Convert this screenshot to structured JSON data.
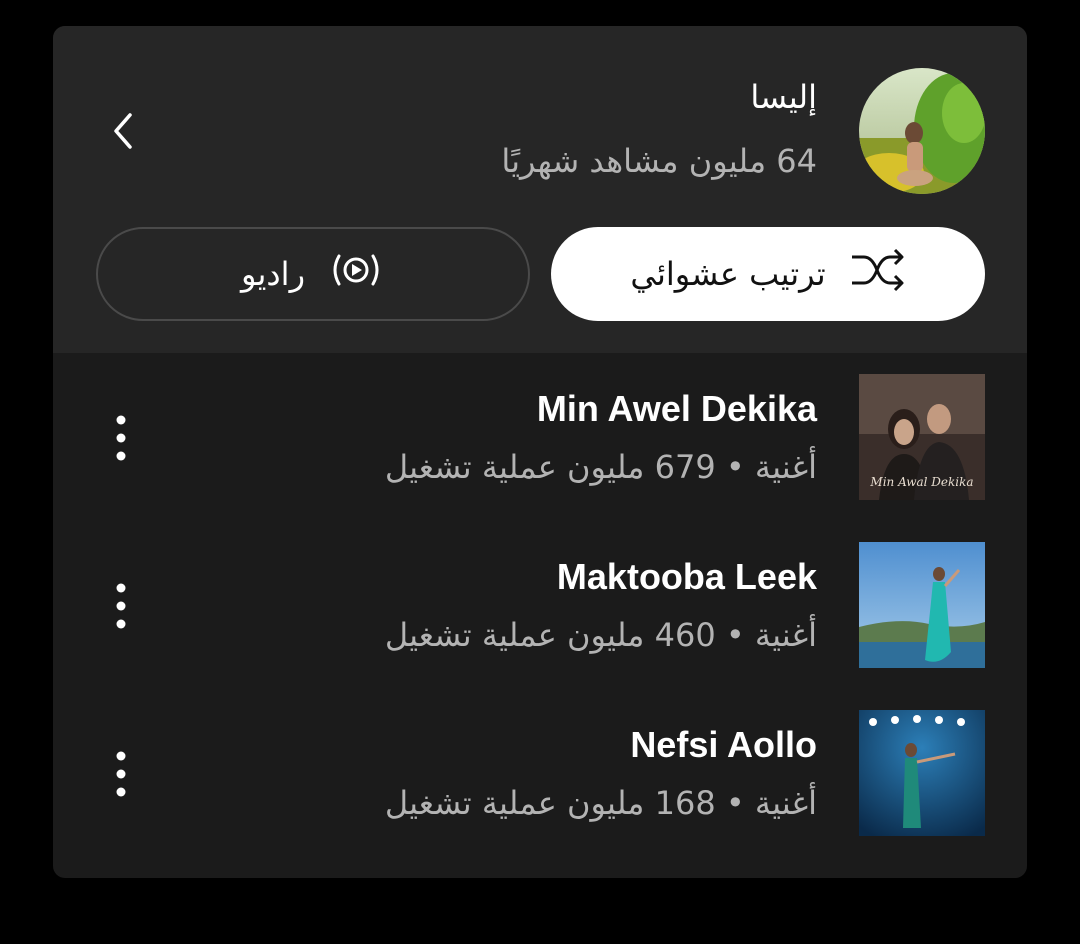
{
  "artist": {
    "name": "إليسا",
    "monthly_listeners": "64 مليون مشاهد شهريًا",
    "avatar_icon": "artist-photo"
  },
  "actions": {
    "shuffle_label": "ترتيب عشوائي",
    "shuffle_icon": "shuffle-icon",
    "radio_label": "راديو",
    "radio_icon": "radio-icon"
  },
  "songs": [
    {
      "title": "Min Awel Dekika",
      "meta": "أغنية • 679 مليون عملية تشغيل"
    },
    {
      "title": "Maktooba Leek",
      "meta": "أغنية • 460 مليون عملية تشغيل"
    },
    {
      "title": "Nefsi Aollo",
      "meta": "أغنية • 168 مليون عملية تشغيل"
    }
  ],
  "colors": {
    "background": "#000000",
    "card": "#1b1b1b",
    "header": "#262626",
    "primary_text": "#ffffff",
    "secondary_text": "#b3b3b3",
    "shuffle_button": "#ffffff"
  }
}
